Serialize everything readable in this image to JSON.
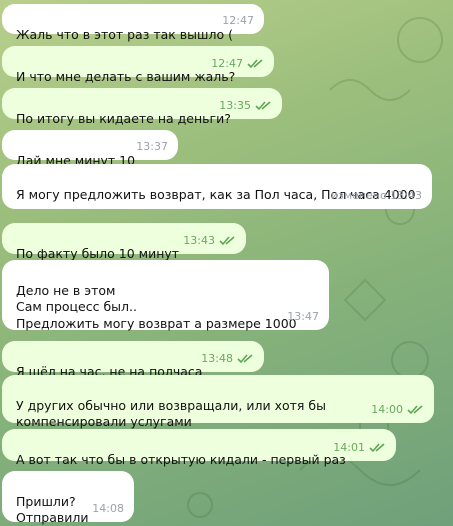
{
  "messages": [
    {
      "dir": "in",
      "text": "Жаль что в этот раз так вышло (",
      "time": "12:47"
    },
    {
      "dir": "out",
      "text": "И что мне делать с вашим жаль?",
      "time": "12:47",
      "read": true
    },
    {
      "dir": "out",
      "text": "По итогу вы кидаете на деньги?",
      "time": "13:35",
      "read": true
    },
    {
      "dir": "in",
      "text": "Дай мне минут 10",
      "time": "13:37"
    },
    {
      "dir": "in",
      "text": "Я могу предложить возврат, как за Пол часа, Пол часа 4000",
      "time": "изменено 13:43"
    },
    {
      "dir": "out",
      "text": "По факту было 10 минут",
      "time": "13:43",
      "read": true
    },
    {
      "dir": "in",
      "text": "Дело не в этом\nСам процесс был..\nПредложить могу возврат а размере 1000",
      "time": "13:47"
    },
    {
      "dir": "out",
      "text": "Я шёл на час, не на полчаса",
      "time": "13:48",
      "read": true
    },
    {
      "dir": "out",
      "text": "У других обычно или возвращали, или хотя бы компенсировали услугами",
      "time": "14:00",
      "read": true
    },
    {
      "dir": "out",
      "text": "А вот так что бы в открытую кидали - первый раз",
      "time": "14:01",
      "read": true
    },
    {
      "dir": "in",
      "text": "Пришли?\nОтправили",
      "time": "14:08"
    }
  ]
}
